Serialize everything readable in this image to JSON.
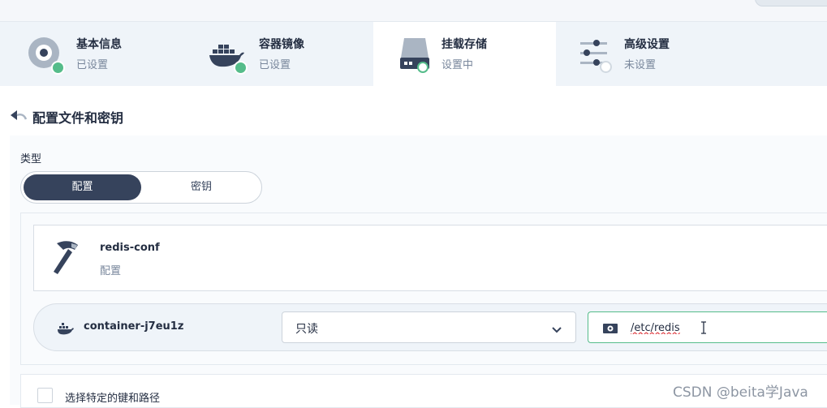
{
  "steps": [
    {
      "title": "基本信息",
      "status": "已设置",
      "icon": "info-disc-icon",
      "state": "done"
    },
    {
      "title": "容器镜像",
      "status": "已设置",
      "icon": "docker-whale-icon",
      "state": "done"
    },
    {
      "title": "挂载存储",
      "status": "设置中",
      "icon": "storage-disk-icon",
      "state": "active"
    },
    {
      "title": "高级设置",
      "status": "未设置",
      "icon": "sliders-icon",
      "state": "pending"
    }
  ],
  "section": {
    "title": "配置文件和密钥",
    "back_icon": "back-arrow-icon"
  },
  "type": {
    "label": "类型",
    "options": [
      "配置",
      "密钥"
    ],
    "selected": "配置"
  },
  "config_item": {
    "name": "redis-conf",
    "type": "配置",
    "icon": "hammer-icon"
  },
  "mount": {
    "container": "container-j7eu1z",
    "access_mode": "只读",
    "mount_path": "/etc/redis"
  },
  "key_path": {
    "label": "选择特定的键和路径",
    "checked": false
  },
  "watermark": "CSDN @beita学Java",
  "colors": {
    "active_green": "#55bc8a",
    "dark_navy": "#36435c",
    "muted": "#79879c"
  }
}
